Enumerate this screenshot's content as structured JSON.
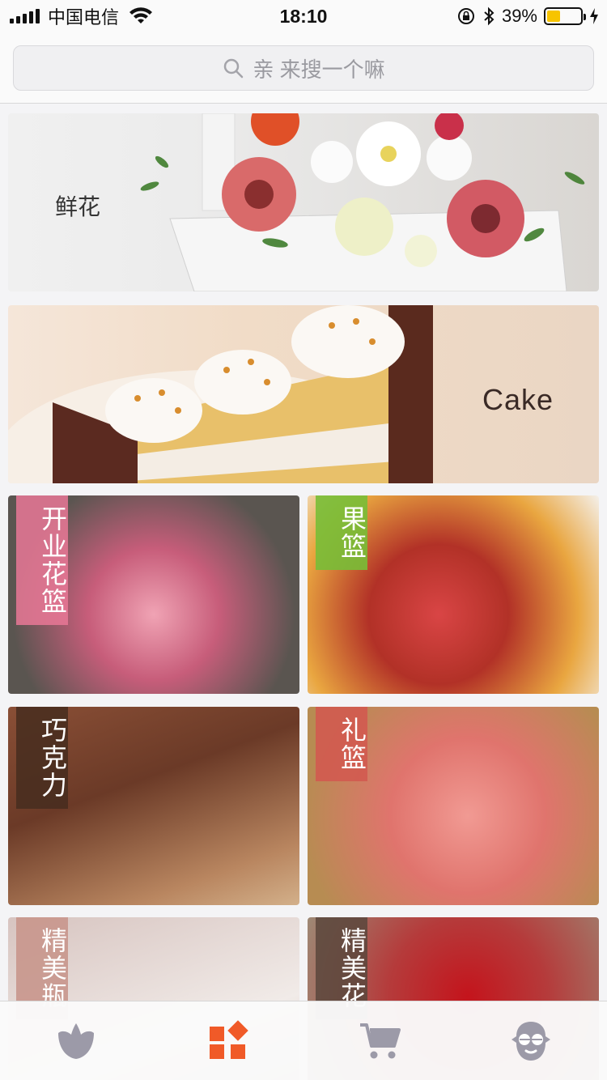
{
  "status_bar": {
    "carrier": "中国电信",
    "time": "18:10",
    "battery_percent": "39%",
    "battery_level": 0.39
  },
  "search": {
    "placeholder": "亲 来搜一个嘛"
  },
  "banners": [
    {
      "label": "鲜花"
    },
    {
      "label": "Cake"
    }
  ],
  "tiles": [
    {
      "label": "开业花篮"
    },
    {
      "label": "果篮"
    },
    {
      "label": "巧克力"
    },
    {
      "label": "礼篮"
    },
    {
      "label": "精美瓶"
    },
    {
      "label": "精美花"
    }
  ],
  "tabbar": {
    "items": [
      {
        "icon": "leaf-icon",
        "active": false
      },
      {
        "icon": "category-icon",
        "active": true
      },
      {
        "icon": "cart-icon",
        "active": false
      },
      {
        "icon": "profile-icon",
        "active": false
      }
    ],
    "active_color": "#f05a28",
    "inactive_color": "#9c9aa8"
  }
}
